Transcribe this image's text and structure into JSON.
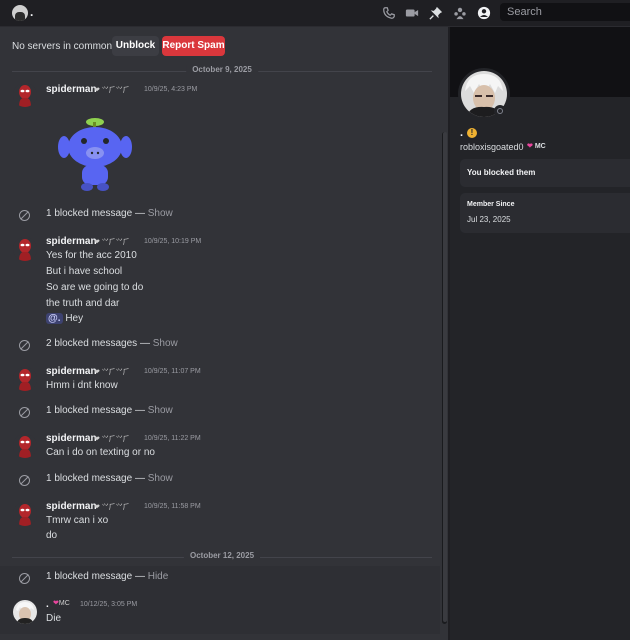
{
  "header": {
    "dm_name": ".",
    "search_placeholder": "Search",
    "icons": [
      "phone-icon",
      "video-icon",
      "pin-icon",
      "add-friend-icon",
      "profile-icon"
    ]
  },
  "actions": {
    "no_servers": "No servers in common",
    "unblock": "Unblock",
    "report_spam": "Report Spam"
  },
  "dividers": [
    "October 9, 2025",
    "October 12, 2025"
  ],
  "messages": [
    {
      "user": "spiderman",
      "time": "10/9/25, 4:23 PM",
      "lines": []
    },
    {
      "blocked": "1 blocked message — ",
      "link": "Show"
    },
    {
      "user": "spiderman",
      "time": "10/9/25, 10:19 PM",
      "lines": [
        "Yes for the acc 2010",
        "But i have school",
        "So are we going to do",
        "the truth and dar",
        "Hey"
      ],
      "mention": "@."
    },
    {
      "blocked": "2 blocked messages — ",
      "link": "Show"
    },
    {
      "user": "spiderman",
      "time": "10/9/25, 11:07 PM",
      "lines": [
        "Hmm i dnt know"
      ]
    },
    {
      "blocked": "1 blocked message — ",
      "link": "Show"
    },
    {
      "user": "spiderman",
      "time": "10/9/25, 11:22 PM",
      "lines": [
        "Can i do on texting or no"
      ]
    },
    {
      "blocked": "1 blocked message — ",
      "link": "Show"
    },
    {
      "user": "spiderman",
      "time": "10/9/25, 11:58 PM",
      "lines": [
        "Tmrw can i xo",
        "do"
      ]
    },
    {
      "blocked": "1 blocked message — ",
      "link": "Hide"
    },
    {
      "user": ".",
      "tag": "MC",
      "time": "10/12/25, 3:05 PM",
      "lines": [
        "Die"
      ]
    }
  ],
  "profile": {
    "display": ".",
    "username": "robloxisgoated0",
    "tag": "MC",
    "blocked_note": "You blocked them",
    "member_since_label": "Member Since",
    "member_since": "Jul 23, 2025"
  },
  "colors": {
    "accent_red": "#da373c",
    "mention_bg": "#3d4270",
    "warn": "#f0b232"
  }
}
